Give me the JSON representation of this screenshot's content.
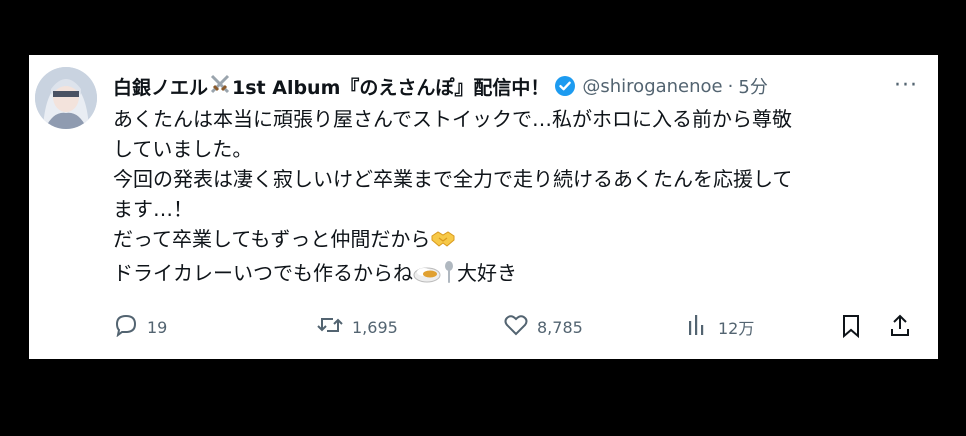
{
  "tweet": {
    "display_name": "白銀ノエル",
    "display_name_suffix": "1st Album『のえさんぽ』配信中！",
    "handle": "@shiroganenoe",
    "separator": "·",
    "time": "5分",
    "more_label": "···",
    "lines": [
      "あくたんは本当に頑張り屋さんでストイックで…私がホロに入る前から尊敬",
      "していました。",
      "今回の発表は凄く寂しいけど卒業まで全力で走り続けるあくたんを応援して",
      "ます…！",
      "だって卒業してもずっと仲間だから",
      "ドライカレーいつでも作るからね",
      "大好き"
    ],
    "emojis": [
      "crossed-swords",
      "handshake",
      "curry-rice",
      "spoon"
    ]
  },
  "actions": {
    "reply_count": "19",
    "retweet_count": "1,695",
    "like_count": "8,785",
    "views_count": "12万"
  },
  "colors": {
    "background": "#000000",
    "card": "#ffffff",
    "text": "#0f1419",
    "secondary": "#536471",
    "verified": "#1d9bf0"
  }
}
